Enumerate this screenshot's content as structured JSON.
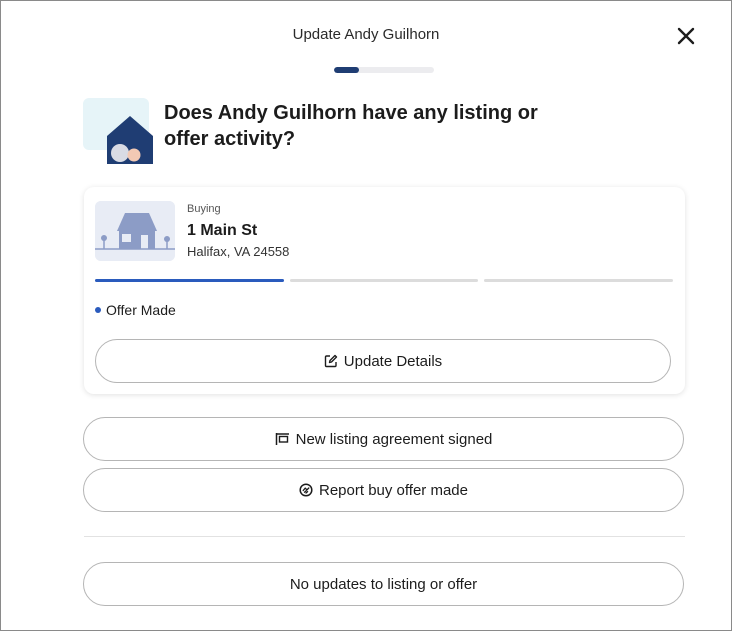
{
  "header": {
    "title": "Update Andy Guilhorn",
    "progress": 0.25
  },
  "question": "Does Andy Guilhorn have any listing or offer activity?",
  "card": {
    "type_label": "Buying",
    "street": "1 Main St",
    "city": "Halifax, VA 24558",
    "steps_total": 3,
    "steps_completed": 1,
    "status": "Offer Made",
    "update_button": "Update Details"
  },
  "actions": {
    "new_listing": "New listing agreement signed",
    "report_offer": "Report buy offer made",
    "no_updates": "No updates to listing or offer"
  },
  "colors": {
    "accent": "#2a5bbd",
    "navy": "#1f3d73",
    "border": "#b5b5b5"
  }
}
